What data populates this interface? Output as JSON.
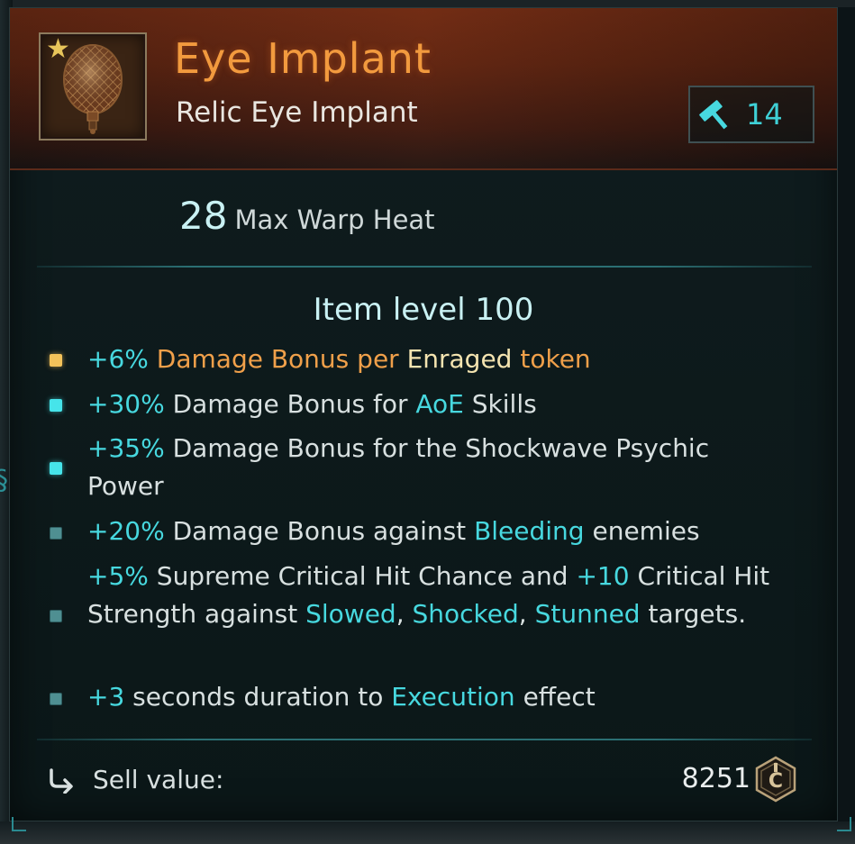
{
  "item": {
    "name": "Eye Implant",
    "type": "Relic Eye Implant",
    "power": "14",
    "stat_value": "28",
    "stat_label": "Max Warp Heat",
    "level": "Item level 100"
  },
  "icons": [
    "star-icon",
    "eye-implant-icon",
    "hammer-icon",
    "return-arrow-icon",
    "credit-coin-icon"
  ],
  "modifiers": [
    {
      "parts": [
        "+6%",
        " Damage Bonus per ",
        "Enraged",
        " token"
      ]
    },
    {
      "parts": [
        "+30%",
        " Damage Bonus for ",
        "AoE",
        " Skills"
      ]
    },
    {
      "parts": [
        "+35%",
        " Damage Bonus for the Shockwave Psychic Power"
      ]
    },
    {
      "parts": [
        "+20%",
        " Damage Bonus against ",
        "Bleeding",
        " enemies"
      ]
    },
    {
      "parts": [
        "+5%",
        " Supreme Critical Hit Chance and ",
        "+10",
        " Critical Hit Strength against ",
        "Slowed",
        ", ",
        "Shocked",
        ", ",
        "Stunned",
        " targets."
      ]
    },
    {
      "parts": [
        "+3",
        " seconds duration to ",
        "Execution",
        " effect"
      ]
    }
  ],
  "sell": {
    "label": "Sell value:",
    "value": "8251"
  },
  "colors": {
    "title": "#f29a3e",
    "accent_cyan": "#47d8df",
    "highlight_orange": "#f0a04a",
    "highlight_yellow": "#f4e4b0",
    "body_text": "#d8e0e0",
    "header_bg": "#5a2412",
    "panel_bg": "#0c1718"
  }
}
